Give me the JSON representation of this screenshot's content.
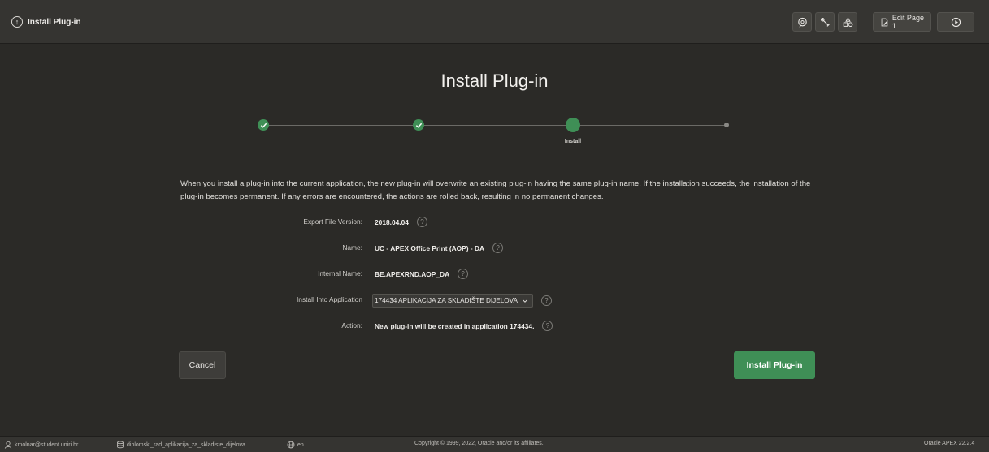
{
  "header": {
    "title": "Install Plug-in",
    "edit_page_label": "Edit Page 1",
    "icons": [
      "quick-sql-icon",
      "developer-bar-icon",
      "shared-components-icon",
      "edit-page-icon",
      "run-icon"
    ]
  },
  "page": {
    "title": "Install Plug-in"
  },
  "wizard": {
    "current_step_label": "Install"
  },
  "description": "When you install a plug-in into the current application, the new plug-in will overwrite an existing plug-in having the same plug-in name. If the installation succeeds, the installation of the plug-in becomes permanent. If any errors are encountered, the actions are rolled back, resulting in no permanent changes.",
  "fields": {
    "export_file_version": {
      "label": "Export File Version:",
      "value": "2018.04.04"
    },
    "name": {
      "label": "Name:",
      "value": "UC - APEX Office Print (AOP) - DA"
    },
    "internal_name": {
      "label": "Internal Name:",
      "value": "BE.APEXRND.AOP_DA"
    },
    "install_into_application": {
      "label": "Install Into Application",
      "value": "174434 APLIKACIJA ZA SKLADIŠTE DIJELOVA"
    },
    "action": {
      "label": "Action:",
      "value": "New plug-in will be created in application 174434."
    }
  },
  "help_glyph": "?",
  "buttons": {
    "cancel": "Cancel",
    "install": "Install Plug-in"
  },
  "footer": {
    "user": "kmolnar@student.uniri.hr",
    "workspace": "diplomski_rad_aplikacija_za_skladiste_dijelova",
    "language": "en",
    "copyright": "Copyright © 1999, 2022, Oracle and/or its affiliates.",
    "version": "Oracle APEX 22.2.4"
  },
  "colors": {
    "accent_green": "#3f8f56",
    "background": "#2b2a27",
    "header": "#353431"
  }
}
